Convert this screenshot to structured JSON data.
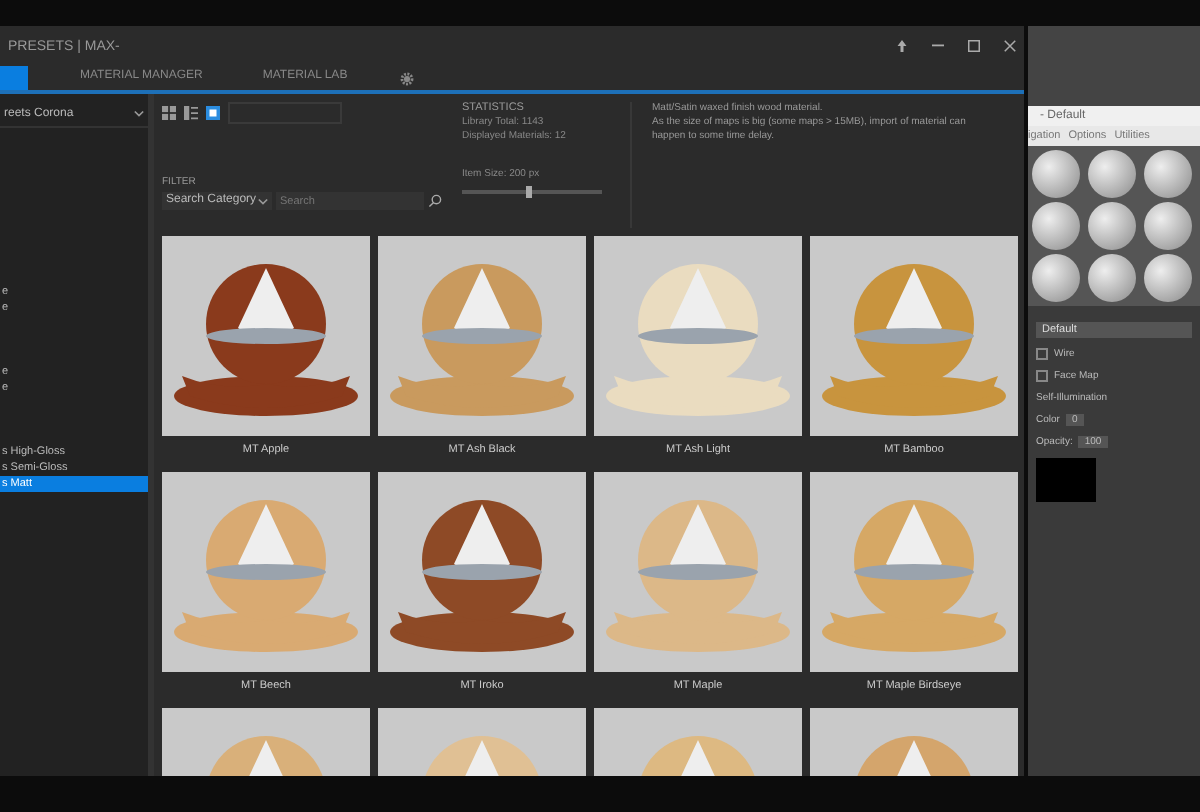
{
  "window": {
    "title": "PRESETS | MAX-"
  },
  "tabs": [
    {
      "selected": true
    },
    {
      "label": "MATERIAL MANAGER",
      "selected": false
    },
    {
      "label": "MATERIAL LAB",
      "selected": false
    }
  ],
  "sidebar": {
    "library": "reets Corona",
    "items": [
      {
        "label": "e",
        "selected": false
      },
      {
        "label": "e",
        "selected": false
      },
      {
        "label": "e",
        "selected": false
      },
      {
        "label": "e",
        "selected": false
      },
      {
        "label": "s High-Gloss",
        "selected": false
      },
      {
        "label": "s Semi-Gloss",
        "selected": false
      },
      {
        "label": "s Matt",
        "selected": true
      }
    ]
  },
  "statistics": {
    "title": "STATISTICS",
    "lines": [
      "Library Total: 1143",
      "Displayed Materials: 12"
    ],
    "item_size": "Item Size: 200 px",
    "level": 0.45
  },
  "description": [
    "Matt/Satin waxed finish wood material.",
    "As the size of maps is big (some maps > 15MB), import of material can",
    "happen to some time delay."
  ],
  "filter": {
    "title": "FILTER",
    "category": "Search Category",
    "placeholder": "Search"
  },
  "materials": [
    {
      "name": "MT Apple",
      "color": "#8a3a1c"
    },
    {
      "name": "MT Ash Black",
      "color": "#c99a5e"
    },
    {
      "name": "MT Ash Light",
      "color": "#eadcc0"
    },
    {
      "name": "MT Bamboo",
      "color": "#c8943e"
    },
    {
      "name": "MT Beech",
      "color": "#d9aa72"
    },
    {
      "name": "MT Iroko",
      "color": "#8e4a26"
    },
    {
      "name": "MT Maple",
      "color": "#dcb888"
    },
    {
      "name": "MT Maple Birdseye",
      "color": "#d6a865"
    },
    {
      "color": "#d9b07a"
    },
    {
      "color": "#e0c094"
    },
    {
      "color": "#ddb982"
    },
    {
      "color": "#d4a56c"
    }
  ],
  "editor": {
    "title": "- Default",
    "menu": [
      "igation",
      "Options",
      "Utilities"
    ],
    "dropdown": "Default",
    "checks": [
      {
        "label": "Wire",
        "checked": false
      },
      {
        "label": "Face Map",
        "checked": false
      }
    ],
    "self_illum": "Self-Illumination",
    "color_label": "Color",
    "color_value": "0",
    "opacity_label": "Opacity:",
    "opacity_value": "100"
  }
}
